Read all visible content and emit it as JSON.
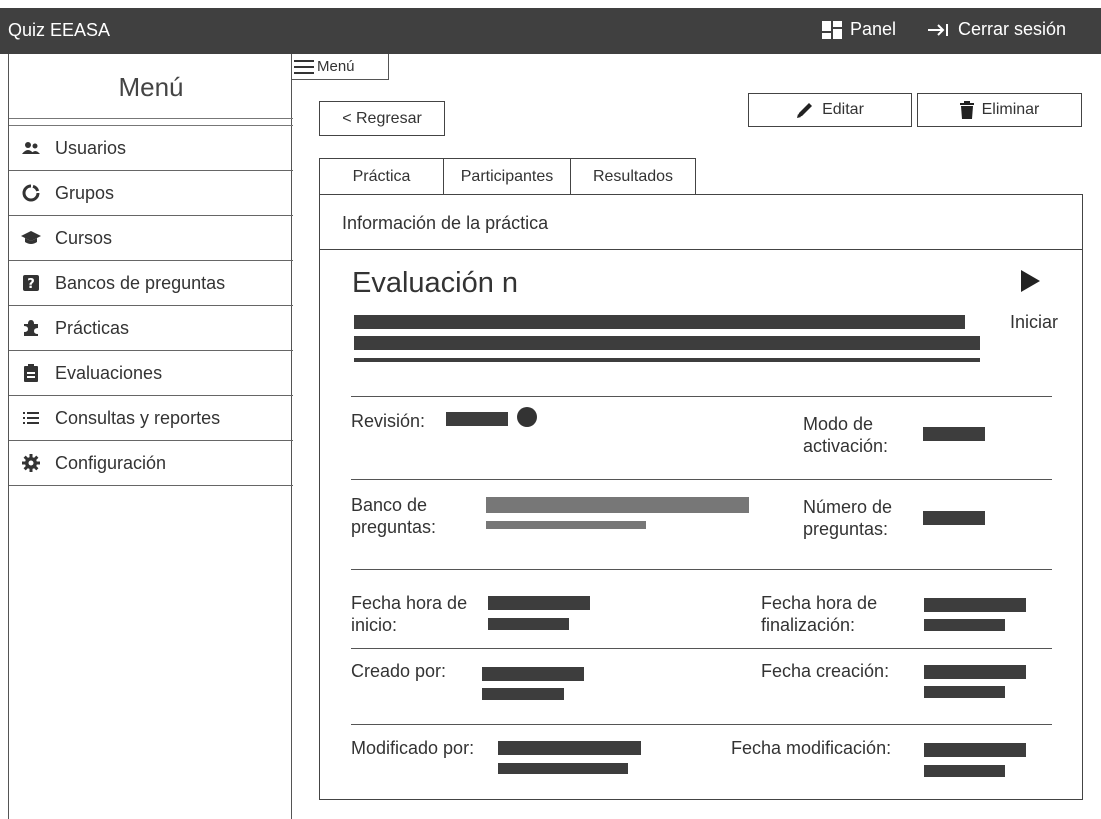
{
  "topbar": {
    "app_title": "Quiz EEASA",
    "panel_label": "Panel",
    "logout_label": "Cerrar sesión"
  },
  "sidebar": {
    "title": "Menú",
    "items": [
      {
        "label": "Usuarios",
        "icon": "users-icon"
      },
      {
        "label": "Grupos",
        "icon": "circle-notch-icon"
      },
      {
        "label": "Cursos",
        "icon": "graduation-cap-icon"
      },
      {
        "label": "Bancos de preguntas",
        "icon": "question-square-icon"
      },
      {
        "label": "Prácticas",
        "icon": "puzzle-icon"
      },
      {
        "label": "Evaluaciones",
        "icon": "clipboard-icon"
      },
      {
        "label": "Consultas y reportes",
        "icon": "list-icon"
      },
      {
        "label": "Configuración",
        "icon": "gear-icon"
      }
    ]
  },
  "menu_toggle": {
    "label": "Menú"
  },
  "actions": {
    "back_label": "< Regresar",
    "edit_label": "Editar",
    "delete_label": "Eliminar"
  },
  "tabs": [
    {
      "label": "Práctica"
    },
    {
      "label": "Participantes"
    },
    {
      "label": "Resultados"
    }
  ],
  "info_header": "Información de la práctica",
  "evaluation": {
    "title": "Evaluación n",
    "start_label": "Iniciar"
  },
  "fields": {
    "revision": "Revisión:",
    "activation_mode": "Modo de activación:",
    "question_bank": "Banco de preguntas:",
    "question_count": "Número de preguntas:",
    "start_datetime": "Fecha hora de inicio:",
    "end_datetime": "Fecha hora de finalización:",
    "created_by": "Creado por:",
    "created_date": "Fecha creación:",
    "modified_by": "Modificado por:",
    "modified_date": "Fecha modificación:"
  },
  "colors": {
    "topbar_bg": "#404040",
    "placeholder_bar": "#3d3d3d",
    "placeholder_bar_light": "#777777"
  }
}
